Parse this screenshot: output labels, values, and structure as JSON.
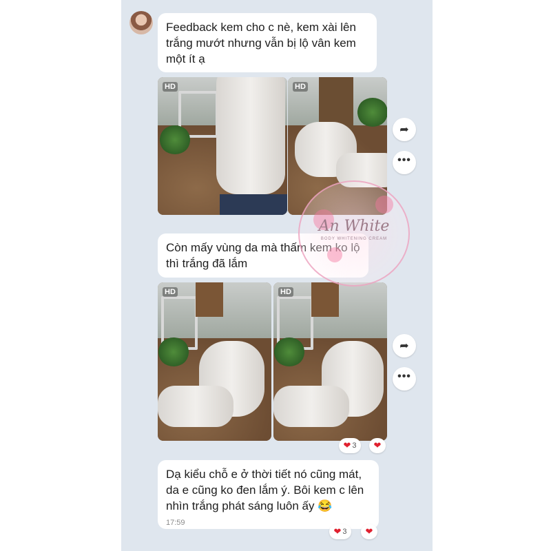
{
  "messages": [
    {
      "text": "Feedback kem cho c nè, kem xài lên trắng mướt nhưng vẫn bị lộ vân kem một ít ạ"
    },
    {
      "text": "Còn mấy vùng da mà thấm kem ko lộ thì trắng đã lắm"
    },
    {
      "text": "Dạ kiểu chỗ e ở thời tiết nó cũng mát, da e cũng ko đen lắm ý. Bôi kem c lên nhìn trắng phát sáng luôn ấy 😂",
      "time": "17:59"
    }
  ],
  "photo_badge": "HD",
  "reactions": {
    "heart": "❤",
    "count": "3"
  },
  "actions": {
    "share_icon": "➦",
    "more_icon": "•••"
  },
  "watermark": {
    "brand": "An White",
    "tagline": "BODY WHITENING CREAM"
  },
  "colors": {
    "chat_bg": "#dfe6ee",
    "bubble": "#ffffff",
    "heart": "#e0202e",
    "watermark": "#eca0be"
  }
}
